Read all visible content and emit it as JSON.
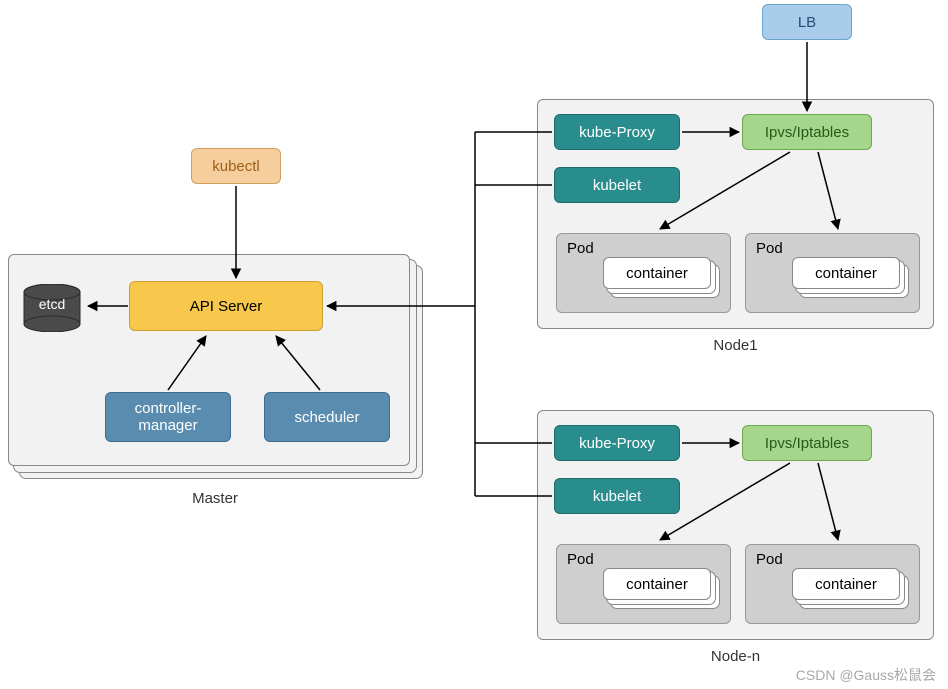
{
  "kubectl": "kubectl",
  "master": {
    "label": "Master",
    "etcd": "etcd",
    "api": "API Server",
    "controller": "controller-\nmanager",
    "scheduler": "scheduler"
  },
  "lb": "LB",
  "node1": {
    "label": "Node1",
    "proxy": "kube-Proxy",
    "ipvs": "Ipvs/Iptables",
    "kubelet": "kubelet",
    "pod1": {
      "label": "Pod",
      "container": "container"
    },
    "pod2": {
      "label": "Pod",
      "container": "container"
    }
  },
  "noden": {
    "label": "Node-n",
    "proxy": "kube-Proxy",
    "ipvs": "Ipvs/Iptables",
    "kubelet": "kubelet",
    "pod1": {
      "label": "Pod",
      "container": "container"
    },
    "pod2": {
      "label": "Pod",
      "container": "container"
    }
  },
  "watermark": "CSDN @Gauss松鼠会"
}
